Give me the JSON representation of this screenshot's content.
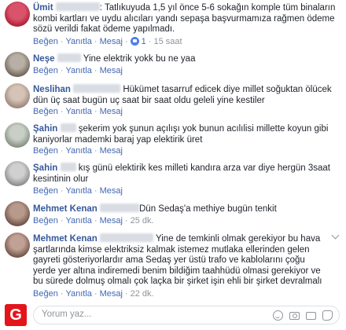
{
  "actions": {
    "like": "Beğen",
    "reply": "Yanıtla",
    "message": "Mesaj",
    "sep": "·"
  },
  "comments": [
    {
      "author": "Ümit",
      "text": ": Tatlıkuyuda 1,5 yıl önce 5-6 sokağın komple tüm binaların kombi kartları ve uydu alıcıları yandı sepaşa başvurmamıza rağmen ödeme sözü verildi fakat ödeme yapılmadı.",
      "reactions": "1",
      "time": "15 saat"
    },
    {
      "author": "Neşe",
      "text": "Yine elektrik yokk bu ne yaa",
      "time": ""
    },
    {
      "author": "Neslihan",
      "text": "Hükümet tasarruf edicek diye millet soğuktan ölücek dün üç saat bugün uç saat bir saat oldu geleli yine kestiler",
      "time": ""
    },
    {
      "author": "Şahin",
      "text": "şekerim yok şunun açılışı yok bunun acılılisi millette koyun gibi kaniyorlar mademki baraj yap elektirik üret",
      "time": ""
    },
    {
      "author": "Şahin",
      "text": "kış günü elektirik kes milleti kandıra arza var diye hergün 3saat kesintinin olur",
      "time": ""
    },
    {
      "author": "Mehmet Kenan",
      "text": "Dün Sedaş'a methiye bugün tenkit",
      "time": "25 dk."
    },
    {
      "author": "Mehmet Kenan",
      "text": "Yine de temkinli olmak gerekiyor bu hava şartlarında kimse elektriksiz kalmak istemez mutlaka ellerinden gelen gayreti gösteriyorlardır ama Sedaş yer üstü trafo ve kablolarını çoğu yerde yer altına indiremedi benim bildiğim taahhüdü olmasi gerekiyor ve bu sürede dolmuş olmalı çok laçka bir şirket işin ehli bir şirket devralmalı",
      "time": "22 dk."
    }
  ],
  "footer": {
    "logo": "G",
    "placeholder": "Yorum yaz..."
  },
  "colors": {
    "author": "#365899",
    "link": "#4267b2",
    "meta": "#90949c",
    "logo": "#e4141b"
  }
}
